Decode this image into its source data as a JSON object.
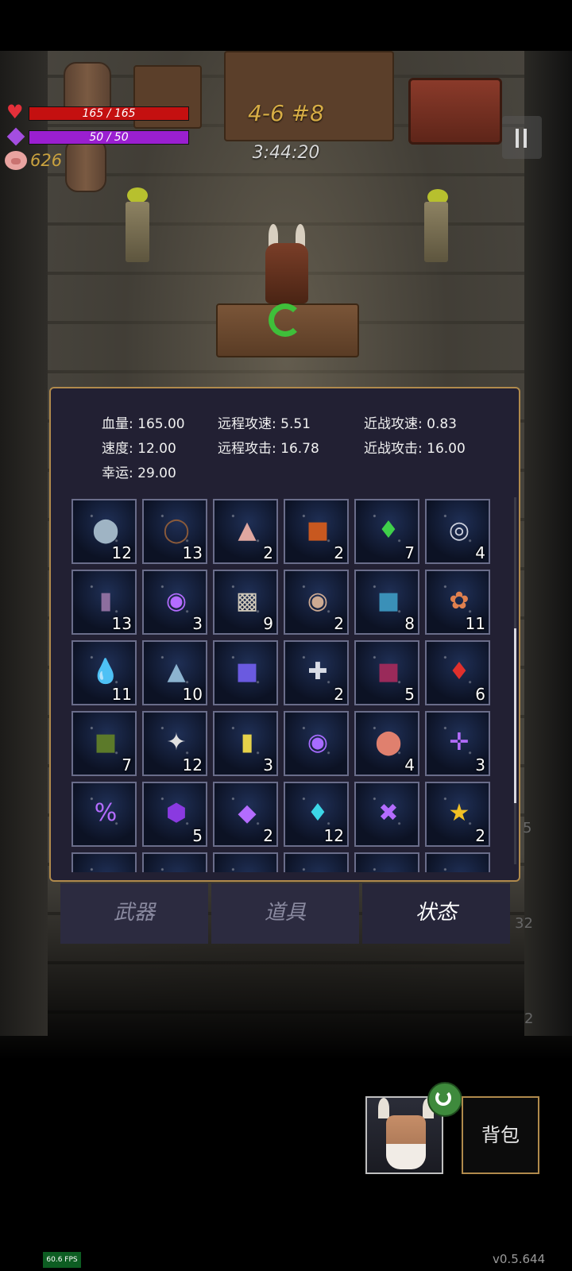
{
  "hud": {
    "hp_text": "165 / 165",
    "hp_fraction": 1.0,
    "mp_text": "50 / 50",
    "mp_fraction": 1.0,
    "gold": "626",
    "stage": "4-6 #8",
    "timer": "3:44:20"
  },
  "stats": {
    "hp": {
      "label": "血量:",
      "value": "165.00"
    },
    "ranged_speed": {
      "label": "远程攻速:",
      "value": "5.51"
    },
    "melee_speed": {
      "label": "近战攻速:",
      "value": "0.83"
    },
    "speed": {
      "label": "速度:",
      "value": "12.00"
    },
    "ranged_attack": {
      "label": "远程攻击:",
      "value": "16.78"
    },
    "melee_attack": {
      "label": "近战攻击:",
      "value": "16.00"
    },
    "luck": {
      "label": "幸运:",
      "value": "29.00"
    }
  },
  "items": [
    {
      "icon": "stone-icon",
      "count": "12"
    },
    {
      "icon": "thorn-wreath-icon",
      "count": "13"
    },
    {
      "icon": "mushroom-icon",
      "count": "2"
    },
    {
      "icon": "spellbook-icon",
      "count": "2"
    },
    {
      "icon": "green-crystal-icon",
      "count": "7"
    },
    {
      "icon": "rings-icon",
      "count": "4"
    },
    {
      "icon": "boots-icon",
      "count": "13"
    },
    {
      "icon": "spiral-rune-icon",
      "count": "3"
    },
    {
      "icon": "ore-icon",
      "count": "9"
    },
    {
      "icon": "vase-icon",
      "count": "2"
    },
    {
      "icon": "blue-book-icon",
      "count": "8"
    },
    {
      "icon": "candies-icon",
      "count": "11"
    },
    {
      "icon": "water-drop-icon",
      "count": "11"
    },
    {
      "icon": "hammer-icon",
      "count": "10"
    },
    {
      "icon": "crystal-book-icon",
      "count": ""
    },
    {
      "icon": "shield-cross-icon",
      "count": "2"
    },
    {
      "icon": "red-book-icon",
      "count": "5"
    },
    {
      "icon": "red-crystal-icon",
      "count": "6"
    },
    {
      "icon": "skull-book-icon",
      "count": "7"
    },
    {
      "icon": "feather-icon",
      "count": "12"
    },
    {
      "icon": "scroll-icon",
      "count": "3"
    },
    {
      "icon": "curve-rune-icon",
      "count": ""
    },
    {
      "icon": "apple-icon",
      "count": "4"
    },
    {
      "icon": "cross-rune-icon",
      "count": "3"
    },
    {
      "icon": "percent-rune-icon",
      "count": ""
    },
    {
      "icon": "purple-gem-icon",
      "count": "5"
    },
    {
      "icon": "diamond-rune-icon",
      "count": "2"
    },
    {
      "icon": "cyan-crystal-icon",
      "count": "12"
    },
    {
      "icon": "x-rune-icon",
      "count": ""
    },
    {
      "icon": "star-trophy-icon",
      "count": "2"
    },
    {
      "icon": "",
      "count": ""
    },
    {
      "icon": "",
      "count": ""
    },
    {
      "icon": "",
      "count": ""
    },
    {
      "icon": "",
      "count": ""
    },
    {
      "icon": "",
      "count": ""
    },
    {
      "icon": "",
      "count": ""
    }
  ],
  "tabs": {
    "weapons": "武器",
    "props": "道具",
    "status": "状态",
    "active": "status"
  },
  "bottom": {
    "bag_label": "背包",
    "fps": "60.6 FPS",
    "version": "v0.5.644",
    "side_counts": [
      "5",
      "32",
      "2"
    ]
  },
  "colors": {
    "hp": "#c41010",
    "mp": "#9a1fd0",
    "gold": "#c9a23f",
    "panel_border": "#b08a4c"
  }
}
